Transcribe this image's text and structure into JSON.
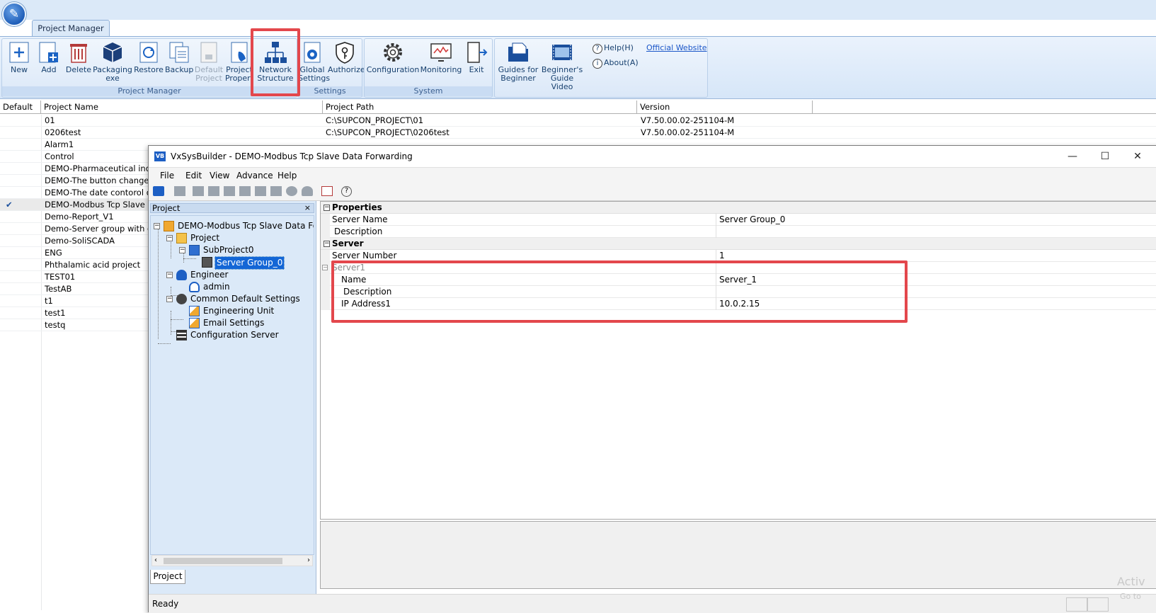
{
  "pm": {
    "ribbon_tab": "Project Manager",
    "groups": {
      "project_manager": "Project Manager",
      "settings": "Settings",
      "system": "System"
    },
    "buttons": {
      "new": "New",
      "add": "Add",
      "delete": "Delete",
      "packaging_1": "Packaging",
      "packaging_2": "exe",
      "restore": "Restore",
      "backup": "Backup",
      "default_1": "Default",
      "default_2": "Project",
      "project_prop_1": "Project",
      "project_prop_2": "Propert",
      "network_1": "Network",
      "network_2": "Structure",
      "global_1": "Global",
      "global_2": "Settings",
      "authorize": "Authorize",
      "configuration": "Configuration",
      "monitoring": "Monitoring",
      "exit": "Exit",
      "guides_1": "Guides for",
      "guides_2": "Beginner",
      "video_1": "Beginner's",
      "video_2": "Guide Video",
      "help": "Help(H)",
      "about": "About(A)",
      "official": "Official Website"
    },
    "columns": [
      "Default",
      "Project Name",
      "Project Path",
      "Version"
    ],
    "rows": [
      {
        "check": "",
        "name": "01",
        "path": "C:\\SUPCON_PROJECT\\01",
        "version": "V7.50.00.02-251104-M"
      },
      {
        "check": "",
        "name": "0206test",
        "path": "C:\\SUPCON_PROJECT\\0206test",
        "version": "V7.50.00.02-251104-M"
      },
      {
        "check": "",
        "name": "Alarm1",
        "path": "",
        "version": ""
      },
      {
        "check": "",
        "name": "Control",
        "path": "",
        "version": ""
      },
      {
        "check": "",
        "name": "DEMO-Pharmaceutical indu",
        "path": "",
        "version": ""
      },
      {
        "check": "",
        "name": "DEMO-The button change c",
        "path": "",
        "version": ""
      },
      {
        "check": "",
        "name": "DEMO-The date contorol qu",
        "path": "",
        "version": ""
      },
      {
        "check": "✔",
        "name": "DEMO-Modbus Tcp Slave D",
        "path": "",
        "version": ""
      },
      {
        "check": "",
        "name": "Demo-Report_V1",
        "path": "",
        "version": ""
      },
      {
        "check": "",
        "name": "Demo-Server group with du",
        "path": "",
        "version": ""
      },
      {
        "check": "",
        "name": "Demo-SoliSCADA",
        "path": "",
        "version": ""
      },
      {
        "check": "",
        "name": "ENG",
        "path": "",
        "version": ""
      },
      {
        "check": "",
        "name": "Phthalamic acid project",
        "path": "",
        "version": ""
      },
      {
        "check": "",
        "name": "TEST01",
        "path": "",
        "version": ""
      },
      {
        "check": "",
        "name": "TestAB",
        "path": "",
        "version": ""
      },
      {
        "check": "",
        "name": "t1",
        "path": "",
        "version": ""
      },
      {
        "check": "",
        "name": "test1",
        "path": "",
        "version": ""
      },
      {
        "check": "",
        "name": "testq",
        "path": "",
        "version": ""
      }
    ]
  },
  "vx": {
    "title": "VxSysBuilder - DEMO-Modbus Tcp Slave Data Forwarding",
    "logo": "VB",
    "menu": [
      "File",
      "Edit",
      "View",
      "Advance",
      "Help"
    ],
    "tree_header": "Project",
    "tree_close": "×",
    "tree": {
      "root": "DEMO-Modbus Tcp Slave Data Forwa",
      "project": "Project",
      "subproject": "SubProject0",
      "server_group": "Server Group_0",
      "engineer": "Engineer",
      "admin": "admin",
      "common": "Common Default Settings",
      "eng_unit": "Engineering Unit",
      "email": "Email Settings",
      "config_server": "Configuration Server"
    },
    "tree_tab": "Project",
    "props": {
      "cat_properties": "Properties",
      "server_name_label": "Server Name",
      "server_name_value": "Server Group_0",
      "description_label": "Description",
      "cat_server": "Server",
      "server_number_label": "Server Number",
      "server_number_value": "1",
      "server1_label": "Server1",
      "name_label": "Name",
      "name_value": "Server_1",
      "desc2_label": "Description",
      "ip_label": "IP Address1",
      "ip_value": "10.0.2.15"
    },
    "status": "Ready",
    "watermark_1": "Activ",
    "watermark_2": "Go to"
  },
  "colors": {
    "highlight_box": "#e3474c",
    "ribbon_bg": "#dbe9f8",
    "selection": "#1366d6"
  }
}
